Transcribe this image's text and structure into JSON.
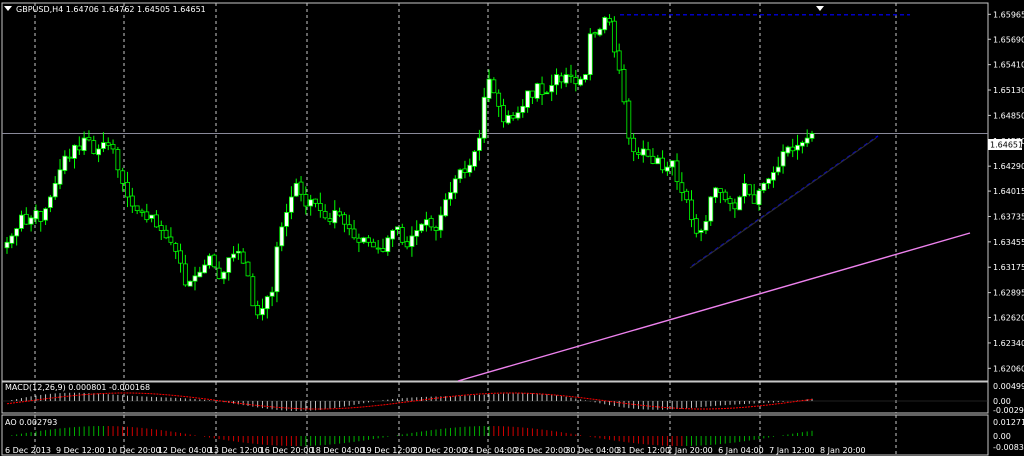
{
  "main_header": "GBPUSD,H4  1.64706 1.64762 1.64505 1.64651",
  "macd_header": "MACD(12,26,9) 0.000801 -0.000168",
  "ao_header": "AO 0.002793",
  "current_price_label": "1.64651",
  "colors": {
    "background": "#000000",
    "grid": "#c8c8c8",
    "frame": "#c8c8c8",
    "bull_candle": "#ffffff",
    "bear_candle": "#000000",
    "wick": "#00ff00",
    "price_line": "#8a8a9a",
    "trend_blue": "#0000c8",
    "trend_magenta": "#ee82ee",
    "macd_histogram": "#c0c0c0",
    "macd_signal": "#ff0000",
    "ao_up": "#00b000",
    "ao_down": "#d00000"
  },
  "chart_data": {
    "type": "candlestick",
    "symbol": "GBPUSD",
    "timeframe": "H4",
    "ohlc_last": {
      "open": 1.64706,
      "high": 1.64762,
      "low": 1.64505,
      "close": 1.64651
    },
    "y_ticks": [
      "1.65965",
      "1.65690",
      "1.65410",
      "1.65130",
      "1.64850",
      "1.64570",
      "1.64290",
      "1.64015",
      "1.63735",
      "1.63455",
      "1.63175",
      "1.62895",
      "1.62620",
      "1.62340",
      "1.62060"
    ],
    "ylim": [
      1.6192,
      1.6609
    ],
    "x_labels": [
      "6 Dec 2013",
      "9 Dec 12:00",
      "10 Dec 20:00",
      "12 Dec 04:00",
      "13 Dec 12:00",
      "16 Dec 20:00",
      "18 Dec 04:00",
      "19 Dec 12:00",
      "20 Dec 20:00",
      "24 Dec 04:00",
      "26 Dec 20:00",
      "30 Dec 04:00",
      "31 Dec 12:00",
      "2 Jan 20:00",
      "6 Jan 04:00",
      "7 Jan 12:00",
      "8 Jan 20:00"
    ],
    "trendlines": [
      {
        "color": "blue",
        "style": "dashed",
        "from": [
          1.6596,
          1.6596
        ],
        "to": "horizontal"
      },
      {
        "color": "blue",
        "style": "dashed",
        "rising": true
      },
      {
        "color": "magenta",
        "style": "solid",
        "rising": true
      }
    ],
    "closes": [
      1.6345,
      1.6352,
      1.636,
      1.6375,
      1.6365,
      1.6372,
      1.638,
      1.6368,
      1.6382,
      1.6395,
      1.641,
      1.6425,
      1.644,
      1.6438,
      1.6452,
      1.6447,
      1.646,
      1.6458,
      1.6443,
      1.6448,
      1.6455,
      1.6452,
      1.6448,
      1.6425,
      1.641,
      1.6395,
      1.6385,
      1.638,
      1.6378,
      1.637,
      1.6375,
      1.6362,
      1.6358,
      1.635,
      1.6345,
      1.6335,
      1.6322,
      1.6298,
      1.6302,
      1.6308,
      1.6312,
      1.632,
      1.633,
      1.6318,
      1.6305,
      1.6312,
      1.6328,
      1.6332,
      1.6335,
      1.6322,
      1.6308,
      1.6275,
      1.6265,
      1.6272,
      1.6285,
      1.629,
      1.634,
      1.6362,
      1.6378,
      1.6395,
      1.641,
      1.6398,
      1.6385,
      1.6392,
      1.6388,
      1.638,
      1.6372,
      1.6368,
      1.638,
      1.6375,
      1.6365,
      1.636,
      1.635,
      1.6345,
      1.635,
      1.6345,
      1.634,
      1.6338,
      1.6335,
      1.635,
      1.6358,
      1.6362,
      1.6345,
      1.634,
      1.6352,
      1.6358,
      1.6365,
      1.637,
      1.6362,
      1.6358,
      1.6375,
      1.6392,
      1.64,
      1.6415,
      1.6425,
      1.6422,
      1.643,
      1.6445,
      1.646,
      1.6505,
      1.6525,
      1.651,
      1.6495,
      1.6478,
      1.6485,
      1.6482,
      1.6488,
      1.6495,
      1.6512,
      1.6505,
      1.652,
      1.6508,
      1.651,
      1.6518,
      1.653,
      1.6522,
      1.653,
      1.6528,
      1.652,
      1.6525,
      1.653,
      1.6575,
      1.6575,
      1.658,
      1.6593,
      1.6588,
      1.6555,
      1.6535,
      1.65,
      1.646,
      1.6445,
      1.6442,
      1.6448,
      1.644,
      1.6432,
      1.6438,
      1.6425,
      1.6428,
      1.6435,
      1.6412,
      1.64,
      1.6392,
      1.637,
      1.6355,
      1.6358,
      1.6368,
      1.6395,
      1.6405,
      1.64,
      1.6392,
      1.6388,
      1.6382,
      1.6395,
      1.641,
      1.6398,
      1.6388,
      1.6402,
      1.641,
      1.6415,
      1.6422,
      1.6428,
      1.6445,
      1.645,
      1.6446,
      1.6452,
      1.6455,
      1.646,
      1.6465
    ],
    "macd": {
      "name": "MACD(12,26,9)",
      "values_text": "0.000801 -0.000168",
      "ticks": [
        "0.004992",
        "0.00",
        "-0.002942"
      ]
    },
    "ao": {
      "name": "AO",
      "value_text": "0.002793",
      "ticks": [
        "0.012711",
        "0.00",
        "-0.00838"
      ]
    }
  }
}
